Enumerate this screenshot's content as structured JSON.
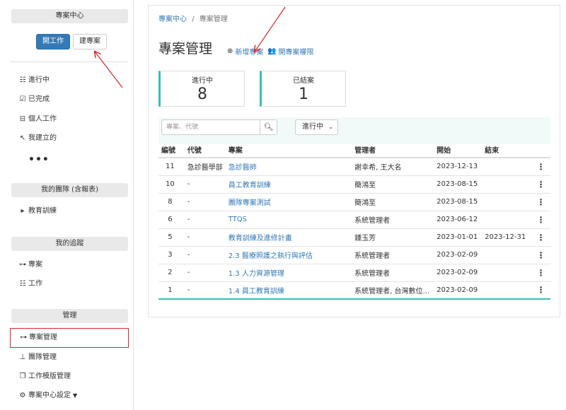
{
  "sidebar": {
    "project_center_heading": "專案中心",
    "open_work_button": "開工作",
    "create_project_button": "建專案",
    "items": [
      {
        "label": "進行中",
        "icon": "list-check-icon"
      },
      {
        "label": "已完成",
        "icon": "check-square-icon"
      },
      {
        "label": "個人工作",
        "icon": "briefcase-icon"
      },
      {
        "label": "我建立的",
        "icon": "pointer-icon"
      }
    ],
    "more": "•••",
    "teams_heading": "我的團隊 (含報表)",
    "team_item": "教育訓練",
    "tracking_heading": "我的追蹤",
    "tracking_items": [
      {
        "label": "專案",
        "icon": "sitemap-icon"
      },
      {
        "label": "工作",
        "icon": "list-check-icon"
      }
    ],
    "admin_heading": "管理",
    "admin_items": [
      {
        "label": "專案管理",
        "icon": "sitemap-icon"
      },
      {
        "label": "團隊管理",
        "icon": "org-chart-icon"
      },
      {
        "label": "工作模版管理",
        "icon": "copy-icon"
      },
      {
        "label": "專案中心設定",
        "icon": "gear-icon"
      }
    ]
  },
  "main": {
    "breadcrumb": {
      "root": "專案中心",
      "separator": "/",
      "current": "專案管理"
    },
    "title": "專案管理",
    "add_project_link": "新增專案",
    "permissions_link": "開專案權限",
    "stats": [
      {
        "label": "進行中",
        "value": "8"
      },
      {
        "label": "已結案",
        "value": "1"
      }
    ],
    "search": {
      "placeholder": "專案、代號"
    },
    "status_filter": {
      "selected": "進行中"
    },
    "table": {
      "headers": [
        "編號",
        "代號",
        "專案",
        "管理者",
        "開始",
        "結束",
        ""
      ],
      "rows": [
        {
          "id": "11",
          "code": "急診醫學部",
          "project": "急診醫師",
          "manager": "謝幸希, 王大名",
          "start": "2023-12-13",
          "end": ""
        },
        {
          "id": "10",
          "code": "-",
          "project": "員工教育訓練",
          "manager": "簡鴻至",
          "start": "2023-08-15",
          "end": ""
        },
        {
          "id": "8",
          "code": "-",
          "project": "團隊專案測試",
          "manager": "簡鴻至",
          "start": "2023-08-15",
          "end": ""
        },
        {
          "id": "6",
          "code": "-",
          "project": "TTQS",
          "manager": "系統管理者",
          "start": "2023-06-12",
          "end": ""
        },
        {
          "id": "5",
          "code": "-",
          "project": "教育訓練及進修計畫",
          "manager": "鍾玉芳",
          "start": "2023-01-01",
          "end": "2023-12-31"
        },
        {
          "id": "3",
          "code": "-",
          "project": "2.3 醫療照護之執行與評估",
          "manager": "系統管理者",
          "start": "2023-02-09",
          "end": ""
        },
        {
          "id": "2",
          "code": "-",
          "project": "1.3 人力資源管理",
          "manager": "系統管理者",
          "start": "2023-02-09",
          "end": ""
        },
        {
          "id": "1",
          "code": "-",
          "project": "1.4 員工教育訓練",
          "manager": "系統管理者, 台灣數位...",
          "start": "2023-02-09",
          "end": ""
        }
      ],
      "row_menu_icon": "⋮"
    }
  },
  "colors": {
    "accent": "#337ab7",
    "teal": "#3cbcb4",
    "highlight": "#d9262b"
  }
}
